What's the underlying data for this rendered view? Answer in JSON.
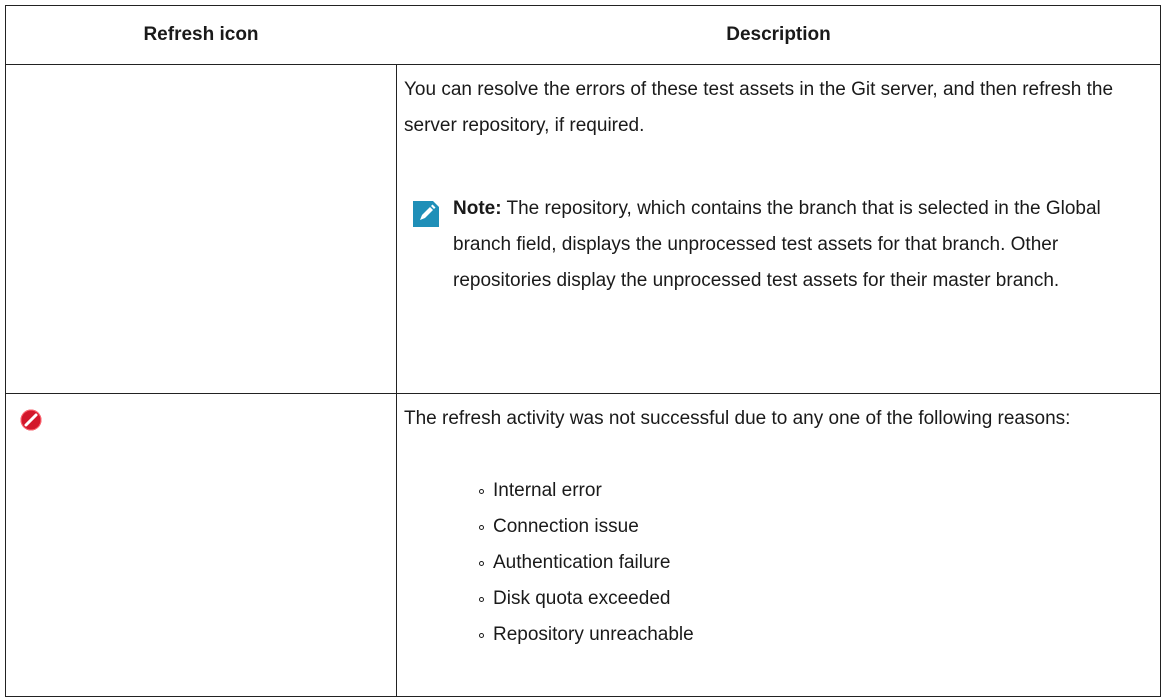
{
  "table": {
    "headers": {
      "icon": "Refresh icon",
      "description": "Description"
    },
    "rows": [
      {
        "icon_name": "none",
        "description_line": "You can resolve the errors of these test assets in the Git server, and then refresh the server repository, if required.",
        "note": {
          "icon_name": "pencil-note-icon",
          "label": "Note:",
          "text": " The repository, which contains the branch that is selected in the Global branch field, displays the unprocessed test assets for that branch. Other repositories display the unprocessed test assets for their master branch."
        }
      },
      {
        "icon_name": "blocked-icon",
        "description_line": "The refresh activity was not successful due to any one of the following reasons:",
        "reasons": [
          "Internal error",
          "Connection issue",
          "Authentication failure",
          "Disk quota exceeded",
          "Repository unreachable"
        ]
      }
    ]
  },
  "colors": {
    "note_icon_bg": "#1f8fb8",
    "blocked_icon": "#d3172b",
    "border": "#222222"
  }
}
